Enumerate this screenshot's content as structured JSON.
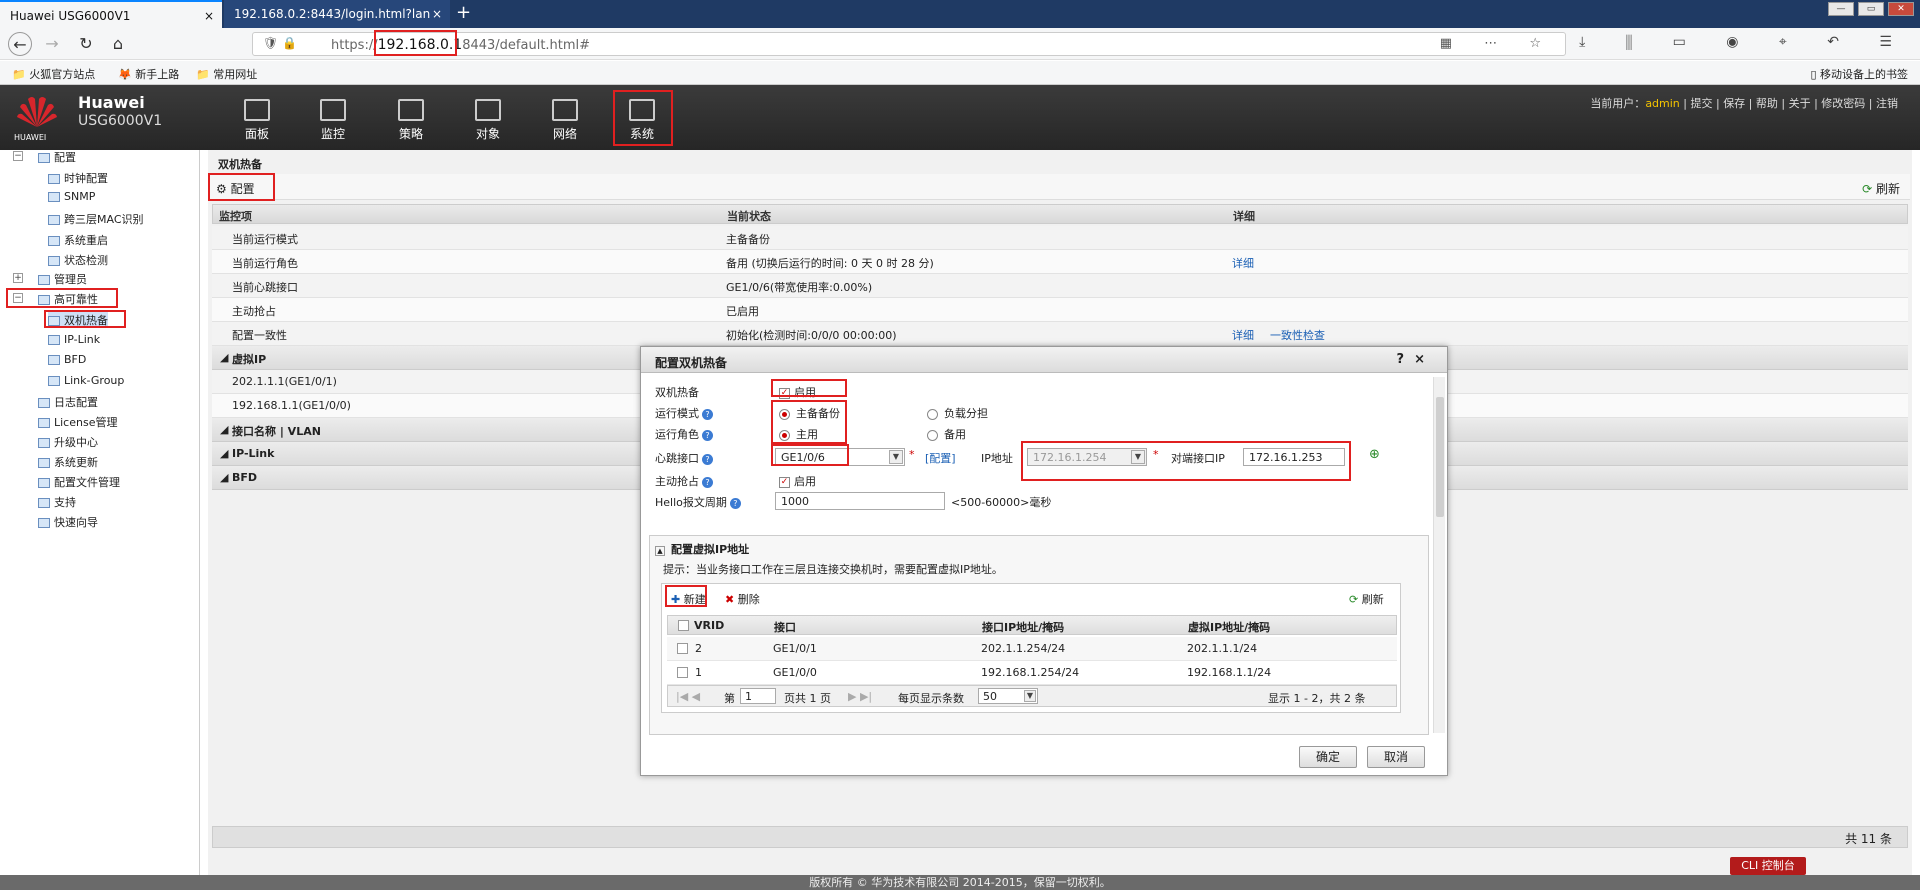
{
  "browser": {
    "tab1": "Huawei USG6000V1",
    "tab2": "192.168.0.2:8443/login.html?lan",
    "tab_close": "×",
    "new_tab": "+",
    "url_prefix": "https://",
    "url_host": "192.168.0.1",
    "url_rest": "8443/default.html#",
    "bookmarks": [
      "火狐官方站点",
      "新手上路",
      "常用网址"
    ],
    "mobile_bm": "移动设备上的书签"
  },
  "header": {
    "brand": "Huawei",
    "model": "USG6000V1",
    "logo_text": "HUAWEI",
    "menu": [
      "面板",
      "监控",
      "策略",
      "对象",
      "网络",
      "系统"
    ],
    "current_user_label": "当前用户：",
    "user": "admin",
    "links": [
      "提交",
      "保存",
      "帮助",
      "关于",
      "修改密码",
      "注销"
    ]
  },
  "sidebar": {
    "items": [
      "配置",
      "时钟配置",
      "SNMP",
      "跨三层MAC识别",
      "系统重启",
      "状态检测",
      "管理员",
      "高可靠性",
      "双机热备",
      "IP-Link",
      "BFD",
      "Link-Group",
      "日志配置",
      "License管理",
      "升级中心",
      "系统更新",
      "配置文件管理",
      "支持",
      "快速向导"
    ]
  },
  "main": {
    "title": "双机热备",
    "config_btn": "配置",
    "refresh": "刷新",
    "headers": [
      "监控项",
      "当前状态",
      "详细"
    ],
    "rows": [
      [
        "当前运行模式",
        "主备备份",
        ""
      ],
      [
        "当前运行角色",
        "备用 (切换后运行的时间: 0 天 0 时 28 分)",
        "详细"
      ],
      [
        "当前心跳接口",
        "GE1/0/6(带宽使用率:0.00%)",
        ""
      ],
      [
        "主动抢占",
        "已启用",
        ""
      ],
      [
        "配置一致性",
        "初始化(检测时间:0/0/0 00:00:00)",
        "详细"
      ]
    ],
    "consistency_check": "一致性检查",
    "section_vip": "虚拟IP",
    "vip_rows": [
      "202.1.1.1(GE1/0/1)",
      "192.168.1.1(GE1/0/0)"
    ],
    "section_iface": "接口名称 | VLAN",
    "section_iplink": "IP-Link",
    "section_bfd": "BFD",
    "total": "共 11 条",
    "cli": "CLI 控制台",
    "copyright": "版权所有 © 华为技术有限公司 2014-2015，保留一切权利。"
  },
  "dialog": {
    "title": "配置双机热备",
    "help": "?",
    "close": "×",
    "hot_label": "双机热备",
    "enable": "启用",
    "mode_label": "运行模式",
    "mode_opt1": "主备备份",
    "mode_opt2": "负载分担",
    "role_label": "运行角色",
    "role_opt1": "主用",
    "role_opt2": "备用",
    "hb_label": "心跳接口",
    "hb_value": "GE1/0/6",
    "hb_config": "[配置]",
    "ip_label": "IP地址",
    "ip_value": "172.16.1.254",
    "peer_label": "对端接口IP",
    "peer_value": "172.16.1.253",
    "preempt_label": "主动抢占",
    "preempt_enable": "启用",
    "hello_label": "Hello报文周期",
    "hello_value": "1000",
    "hello_hint": "<500-60000>毫秒",
    "vip_section": "配置虚拟IP地址",
    "tip": "提示：当业务接口工作在三层且连接交换机时，需要配置虚拟IP地址。",
    "new_btn": "新建",
    "del_btn": "删除",
    "refresh": "刷新",
    "grid_headers": [
      "VRID",
      "接口",
      "接口IP地址/掩码",
      "虚拟IP地址/掩码"
    ],
    "grid_rows": [
      [
        "2",
        "GE1/0/1",
        "202.1.1.254/24",
        "202.1.1.1/24"
      ],
      [
        "1",
        "GE1/0/0",
        "192.168.1.254/24",
        "192.168.1.1/24"
      ]
    ],
    "pager_page_label": "第",
    "pager_page": "1",
    "pager_total": "页共 1 页",
    "pager_size_label": "每页显示条数",
    "pager_size": "50",
    "pager_info": "显示 1 - 2，共 2 条",
    "ok": "确定",
    "cancel": "取消"
  },
  "colors": {
    "highlight": "#e02020",
    "accent": "#f3c300",
    "link": "#1a5fb4"
  }
}
